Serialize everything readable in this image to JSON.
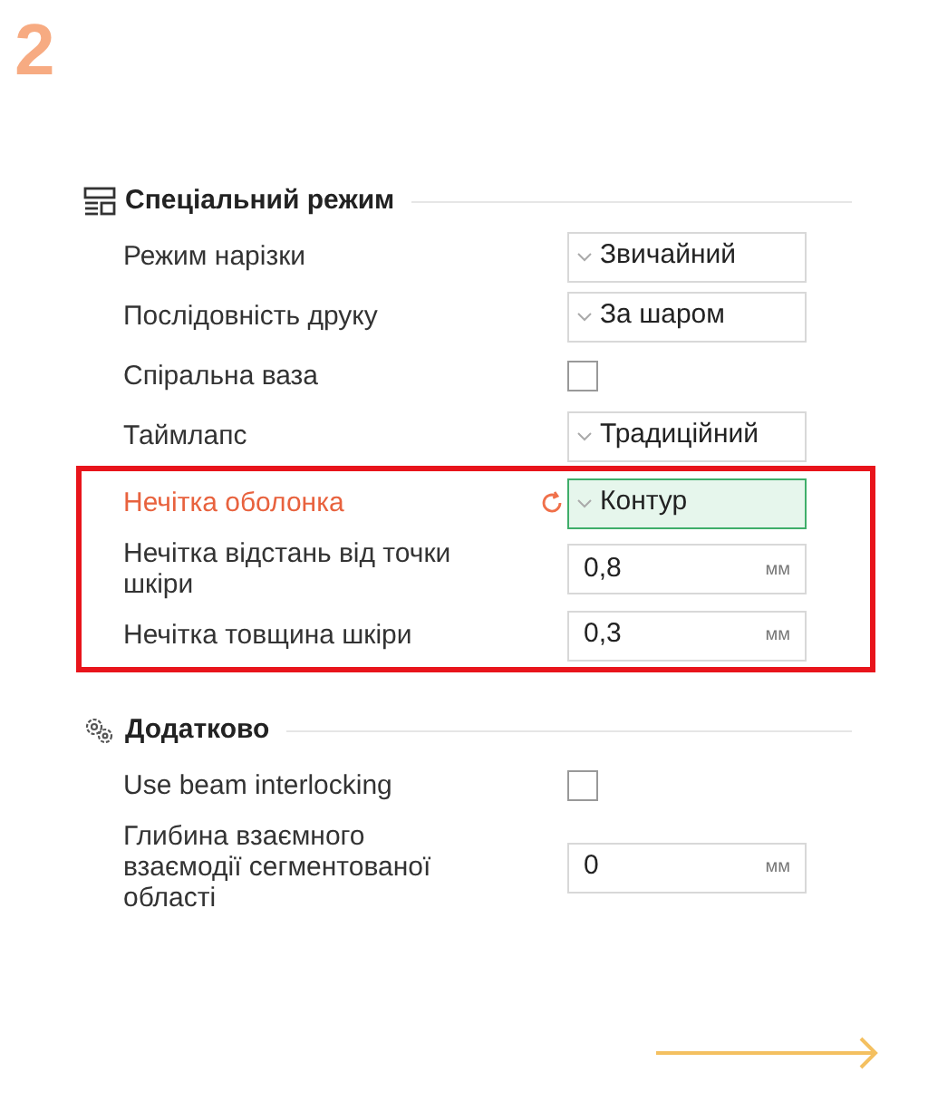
{
  "step": "2",
  "sections": [
    {
      "title": "Спеціальний режим",
      "groups": [
        {
          "highlighted": false,
          "rows": [
            {
              "kind": "dropdown",
              "label": "Режим нарізки",
              "value": "Звичайний",
              "modified": false
            },
            {
              "kind": "dropdown",
              "label": "Послідовність друку",
              "value": "За шаром",
              "modified": false
            },
            {
              "kind": "checkbox",
              "label": "Спіральна ваза",
              "checked": false
            },
            {
              "kind": "dropdown",
              "label": "Таймлапс",
              "value": "Традиційний",
              "modified": false
            }
          ]
        },
        {
          "highlighted": true,
          "rows": [
            {
              "kind": "dropdown",
              "label": "Нечітка оболонка",
              "value": "Контур",
              "modified": true
            },
            {
              "kind": "number",
              "label": "Нечітка відстань від точки шкіри",
              "value": "0,8",
              "unit": "мм"
            },
            {
              "kind": "number",
              "label": "Нечітка товщина шкіри",
              "value": "0,3",
              "unit": "мм"
            }
          ]
        }
      ]
    },
    {
      "title": "Додатково",
      "groups": [
        {
          "highlighted": false,
          "rows": [
            {
              "kind": "checkbox",
              "label": "Use beam interlocking",
              "checked": false
            },
            {
              "kind": "number",
              "label": "Глибина взаємного взаємодії сегментованої області",
              "value": "0",
              "unit": "мм"
            }
          ]
        }
      ]
    }
  ]
}
